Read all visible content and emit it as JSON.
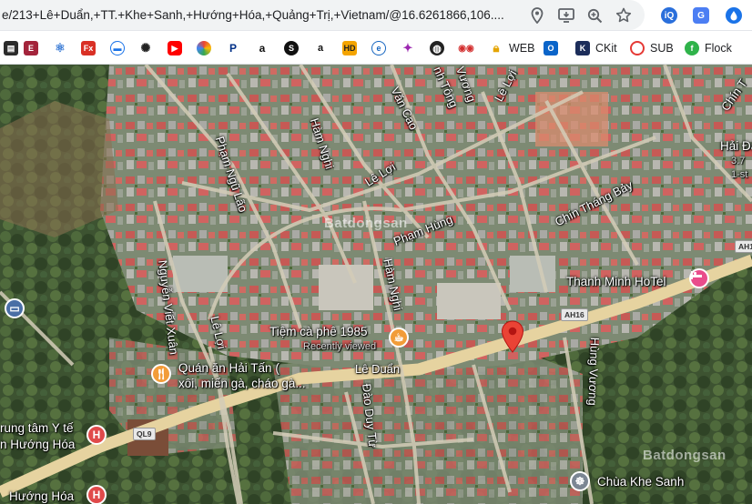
{
  "address_bar": {
    "url": "e/213+Lê+Duẩn,+TT.+Khe+Sanh,+Hướng+Hóa,+Quảng+Trị,+Vietnam/@16.6261866,106...."
  },
  "bookmarks": [
    {
      "label": "WEB"
    },
    {
      "label": "CKit"
    },
    {
      "label": "SUB"
    },
    {
      "label": "Flock"
    }
  ],
  "map": {
    "streets": {
      "le_duan": "Lê Duẩn",
      "le_loi_top": "Lê Lợi",
      "le_loi_mid": "Lê Lợi",
      "le_loi_left": "Lê Lợi",
      "ham_nghi_top": "Hàm Nghi",
      "ham_nghi_bottom": "Hàm Nghi",
      "van_cao": "Văn Cao",
      "anh_tong": "nh Tông",
      "vuong": "Vương",
      "chin_thang_bay": "Chín Tháng Bảy",
      "pham_ngu_lao": "Phạm Ngũ Lão",
      "pham_hung": "Phạm Hùng",
      "nguyen_viet_xuan": "Nguyễn Viết Xuân",
      "dao_duy_tu": "Đào Duy Từ",
      "hung_vuong": "Hùng Vương",
      "chin_t_right": "Chín T"
    },
    "shields": {
      "ah16_mid": "AH16",
      "ah16_right": "AH1",
      "ql9": "QL9"
    },
    "pois": {
      "thanh_minh": "Thanh Minh HoTel",
      "tiem_ca_phe": "Tiệm cà phê 1985",
      "recently_viewed": "Recently viewed",
      "quan_an_line1": "Quán ăn Hải Tấn (",
      "quan_an_line2": "xôi, miến gà, cháo gà...",
      "trung_tam_line1": "rung tâm Y tế",
      "trung_tam_line2": "n Hướng Hóa",
      "huong_hoa_bottom": "Hướng Hóa",
      "chua_khe_sanh": "Chùa Khe Sanh",
      "hai_dang": "Hải Đăng",
      "rating": "3.7",
      "rating_sub": "1-st"
    },
    "watermarks": {
      "center": "Batdongsan",
      "bottom_right": "Batdongsan"
    }
  },
  "colors": {
    "pin_red": "#ea4335",
    "hotel_pink": "#e94c8b",
    "food_orange": "#f29c38",
    "hospital_red": "#e04a4a",
    "road_main": "#e6d3a0"
  }
}
